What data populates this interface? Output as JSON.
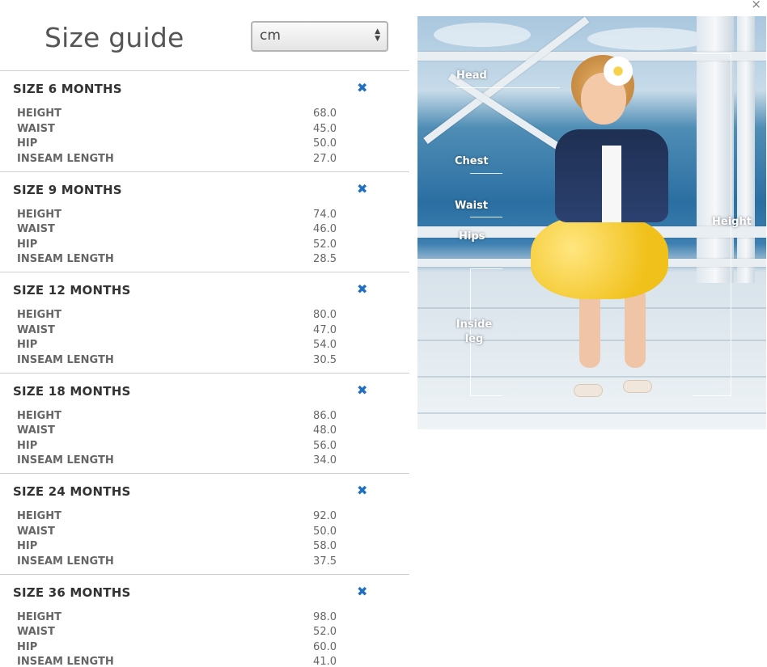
{
  "title": "Size guide",
  "unit_select": {
    "value": "cm"
  },
  "close_glyph": "×",
  "remove_glyph": "✖",
  "sizes": [
    {
      "label": "SIZE 6 MONTHS",
      "rows": [
        {
          "name": "HEIGHT",
          "value": "68.0"
        },
        {
          "name": "WAIST",
          "value": "45.0"
        },
        {
          "name": "HIP",
          "value": "50.0"
        },
        {
          "name": "INSEAM LENGTH",
          "value": "27.0"
        }
      ]
    },
    {
      "label": "SIZE 9 MONTHS",
      "rows": [
        {
          "name": "HEIGHT",
          "value": "74.0"
        },
        {
          "name": "WAIST",
          "value": "46.0"
        },
        {
          "name": "HIP",
          "value": "52.0"
        },
        {
          "name": "INSEAM LENGTH",
          "value": "28.5"
        }
      ]
    },
    {
      "label": "SIZE 12 MONTHS",
      "rows": [
        {
          "name": "HEIGHT",
          "value": "80.0"
        },
        {
          "name": "WAIST",
          "value": "47.0"
        },
        {
          "name": "HIP",
          "value": "54.0"
        },
        {
          "name": "INSEAM LENGTH",
          "value": "30.5"
        }
      ]
    },
    {
      "label": "SIZE 18 MONTHS",
      "rows": [
        {
          "name": "HEIGHT",
          "value": "86.0"
        },
        {
          "name": "WAIST",
          "value": "48.0"
        },
        {
          "name": "HIP",
          "value": "56.0"
        },
        {
          "name": "INSEAM LENGTH",
          "value": "34.0"
        }
      ]
    },
    {
      "label": "SIZE 24 MONTHS",
      "rows": [
        {
          "name": "HEIGHT",
          "value": "92.0"
        },
        {
          "name": "WAIST",
          "value": "50.0"
        },
        {
          "name": "HIP",
          "value": "58.0"
        },
        {
          "name": "INSEAM LENGTH",
          "value": "37.5"
        }
      ]
    },
    {
      "label": "SIZE 36 MONTHS",
      "rows": [
        {
          "name": "HEIGHT",
          "value": "98.0"
        },
        {
          "name": "WAIST",
          "value": "52.0"
        },
        {
          "name": "HIP",
          "value": "60.0"
        },
        {
          "name": "INSEAM LENGTH",
          "value": "41.0"
        }
      ]
    }
  ],
  "photo_labels": {
    "head": "Head",
    "chest": "Chest",
    "waist": "Waist",
    "hips": "Hips",
    "inside_leg": "Inside leg",
    "height": "Height"
  },
  "colors": {
    "accent": "#1f6fc3"
  }
}
